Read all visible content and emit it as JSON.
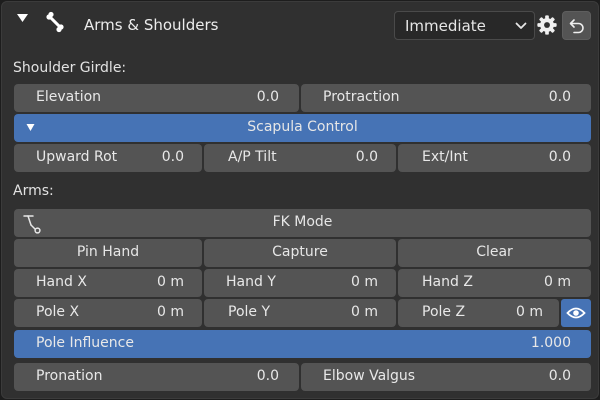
{
  "header": {
    "title": "Arms & Shoulders",
    "mode": "Immediate"
  },
  "shoulder": {
    "section_label": "Shoulder Girdle:",
    "elevation": {
      "label": "Elevation",
      "value": "0.0"
    },
    "protraction": {
      "label": "Protraction",
      "value": "0.0"
    },
    "scapula_label": "Scapula Control",
    "upward_rot": {
      "label": "Upward Rot",
      "value": "0.0"
    },
    "ap_tilt": {
      "label": "A/P Tilt",
      "value": "0.0"
    },
    "ext_int": {
      "label": "Ext/Int",
      "value": "0.0"
    }
  },
  "arms": {
    "section_label": "Arms:",
    "fk_mode_label": "FK Mode",
    "pin_hand_label": "Pin Hand",
    "capture_label": "Capture",
    "clear_label": "Clear",
    "hand_x": {
      "label": "Hand X",
      "value": "0 m"
    },
    "hand_y": {
      "label": "Hand Y",
      "value": "0 m"
    },
    "hand_z": {
      "label": "Hand Z",
      "value": "0 m"
    },
    "pole_x": {
      "label": "Pole X",
      "value": "0 m"
    },
    "pole_y": {
      "label": "Pole Y",
      "value": "0 m"
    },
    "pole_z": {
      "label": "Pole Z",
      "value": "0 m"
    },
    "pole_influence": {
      "label": "Pole Influence",
      "value": "1.000"
    },
    "pronation": {
      "label": "Pronation",
      "value": "0.0"
    },
    "elbow_valgus": {
      "label": "Elbow Valgus",
      "value": "0.0"
    }
  },
  "colors": {
    "panel": "#303030",
    "field": "#545454",
    "accent": "#4673b5"
  },
  "icons": {
    "collapse": "triangle-down-icon",
    "bone": "bone-icon",
    "settings": "gear-icon",
    "reset": "undo-icon",
    "fk": "ik-chain-icon",
    "visibility": "eye-icon"
  }
}
